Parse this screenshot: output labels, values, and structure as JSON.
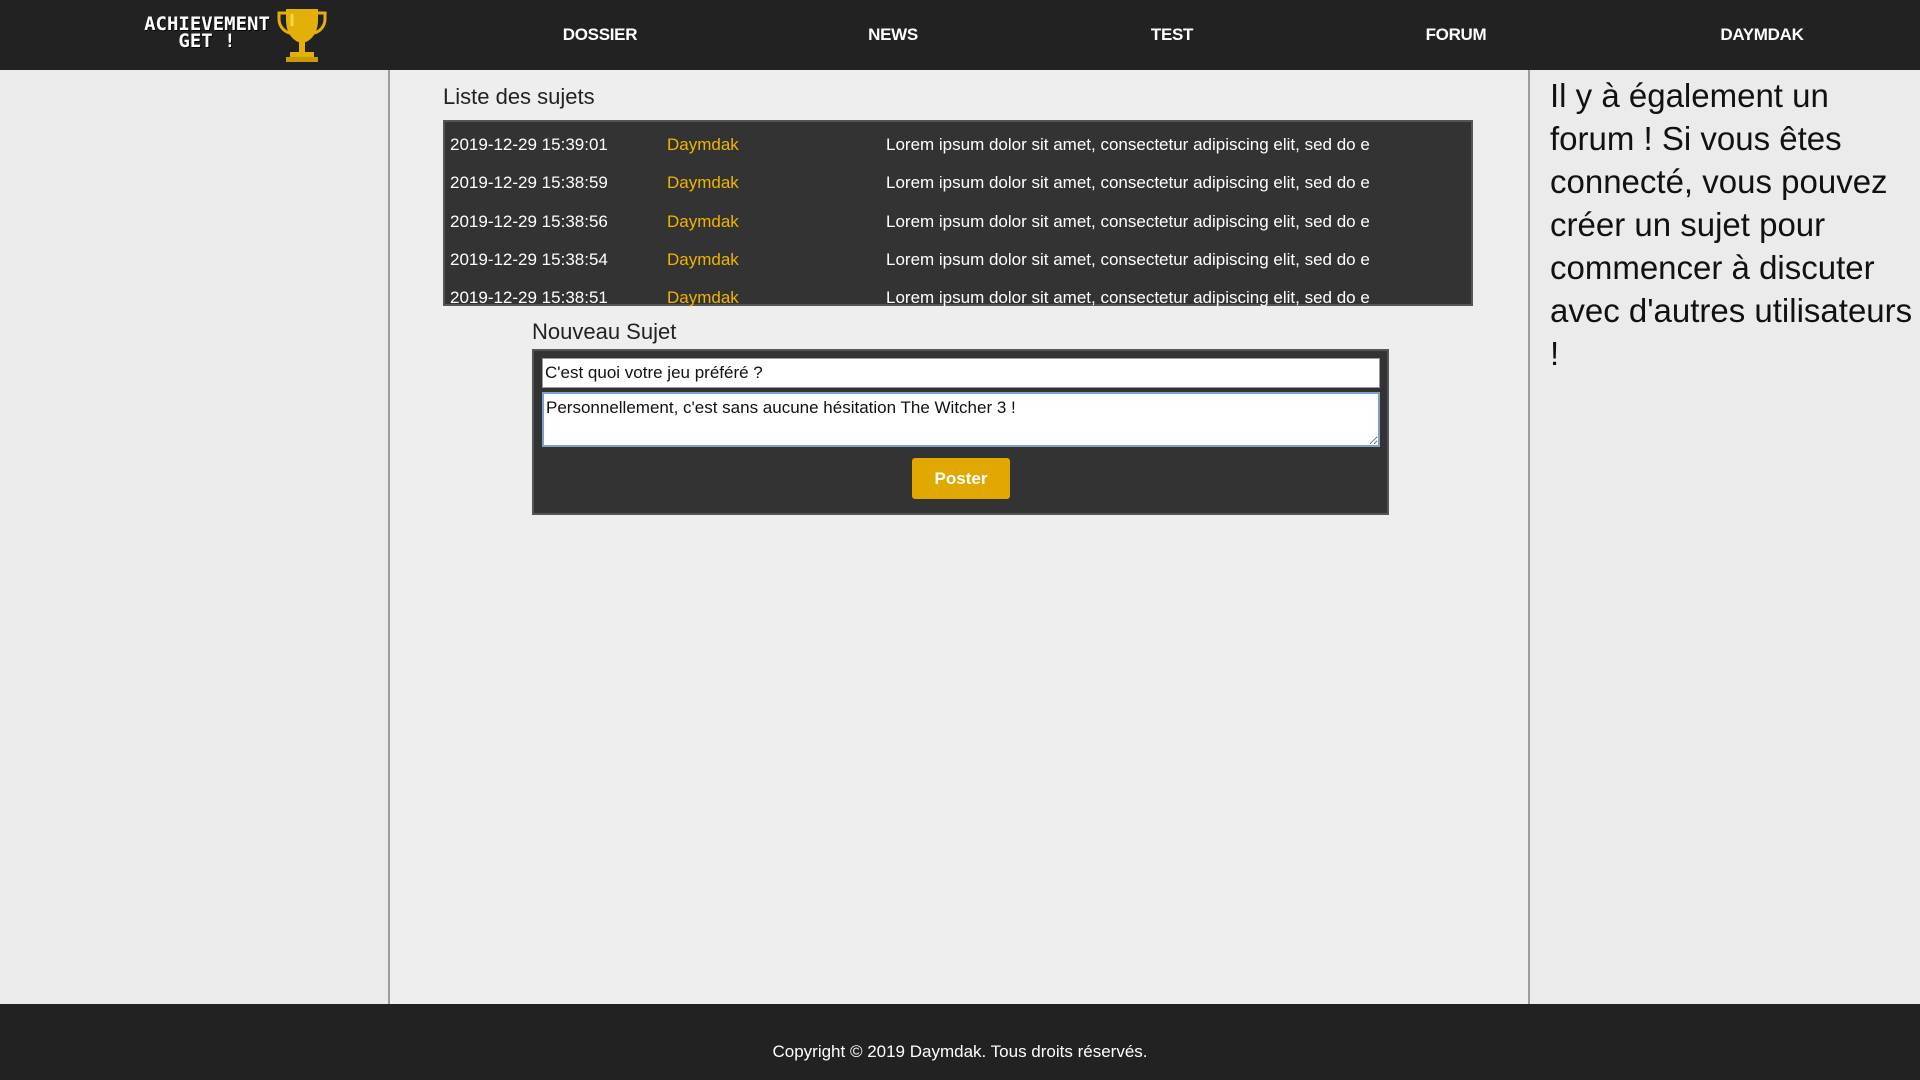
{
  "logo": {
    "line1": "ACHIEVEMENT",
    "line2": "GET !",
    "icon": "trophy-icon",
    "trophy_color": "#e2b007"
  },
  "nav": {
    "items": [
      {
        "label": "DOSSIER"
      },
      {
        "label": "NEWS"
      },
      {
        "label": "TEST"
      },
      {
        "label": "FORUM"
      },
      {
        "label": "DAYMDAK"
      }
    ]
  },
  "topics": {
    "title": "Liste des sujets",
    "rows": [
      {
        "date": "2019-12-29 15:39:01",
        "author": "Daymdak",
        "excerpt": "Lorem ipsum dolor sit amet, consectetur adipiscing elit, sed do e"
      },
      {
        "date": "2019-12-29 15:38:59",
        "author": "Daymdak",
        "excerpt": "Lorem ipsum dolor sit amet, consectetur adipiscing elit, sed do e"
      },
      {
        "date": "2019-12-29 15:38:56",
        "author": "Daymdak",
        "excerpt": "Lorem ipsum dolor sit amet, consectetur adipiscing elit, sed do e"
      },
      {
        "date": "2019-12-29 15:38:54",
        "author": "Daymdak",
        "excerpt": "Lorem ipsum dolor sit amet, consectetur adipiscing elit, sed do e"
      },
      {
        "date": "2019-12-29 15:38:51",
        "author": "Daymdak",
        "excerpt": "Lorem ipsum dolor sit amet, consectetur adipiscing elit, sed do e"
      }
    ]
  },
  "new_topic": {
    "title": "Nouveau Sujet",
    "subject_value": "C'est quoi votre jeu préféré ?",
    "body_value": "Personnellement, c'est sans aucune hésitation The Witcher 3 !",
    "submit_label": "Poster"
  },
  "aside": {
    "text": "Il y à également un forum ! Si vous êtes connecté, vous pouvez créer un sujet pour commencer à discuter avec d'autres utilisateurs !"
  },
  "footer": {
    "copyright": "Copyright © 2019 Daymdak. Tous droits réservés."
  },
  "colors": {
    "header_bg": "#222222",
    "panel_bg": "#333333",
    "accent": "#e0a800",
    "author_link": "#f0b400"
  }
}
